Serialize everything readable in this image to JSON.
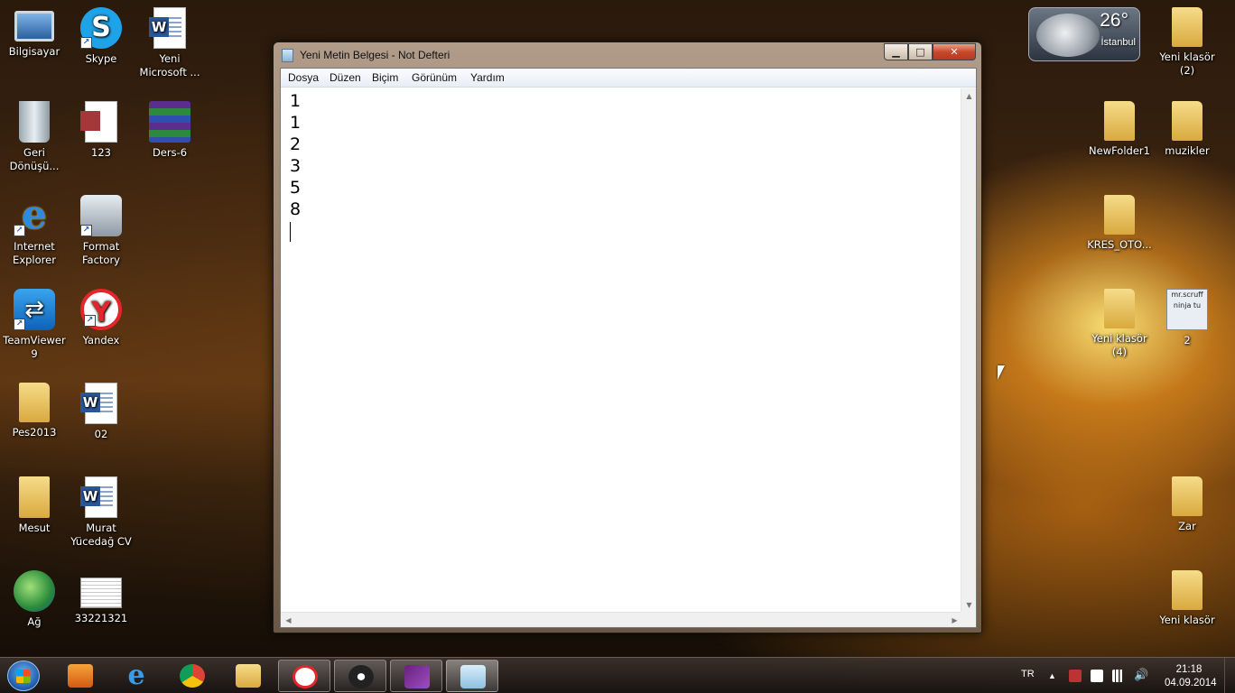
{
  "desktop": {
    "icons_left": [
      {
        "label": "Bilgisayar"
      },
      {
        "label": "Skype"
      },
      {
        "label": "Yeni Microsoft ..."
      },
      {
        "label": "Geri Dönüşü..."
      },
      {
        "label": "123"
      },
      {
        "label": "Ders-6"
      },
      {
        "label": "Internet Explorer"
      },
      {
        "label": "Format Factory"
      },
      {
        "label": "TeamViewer 9"
      },
      {
        "label": "Yandex"
      },
      {
        "label": "Pes2013"
      },
      {
        "label": "02"
      },
      {
        "label": "Mesut"
      },
      {
        "label": "Murat Yücedağ CV"
      },
      {
        "label": "Ağ"
      },
      {
        "label": "33221321"
      }
    ],
    "icons_right": [
      {
        "label": "Yeni klasör (2)"
      },
      {
        "label": "NewFolder1"
      },
      {
        "label": "muzikler"
      },
      {
        "label": "KRES_OTO..."
      },
      {
        "label": "Yeni klasör (4)"
      },
      {
        "label": "2"
      },
      {
        "label": "Zar"
      },
      {
        "label": "Yeni klasör"
      }
    ],
    "mrscruff_text": "mr.scruff ninja tu"
  },
  "weather": {
    "temperature": "26°",
    "city": "İstanbul"
  },
  "notepad": {
    "title": "Yeni Metin Belgesi - Not Defteri",
    "menu": [
      "Dosya",
      "Düzen",
      "Biçim",
      "Görünüm",
      "Yardım"
    ],
    "lines": [
      "1",
      "1",
      "2",
      "3",
      "5",
      "8"
    ]
  },
  "taskbar": {
    "language": "TR",
    "time": "21:18",
    "date": "04.09.2014"
  },
  "colors": {
    "window_close": "#c74a2e",
    "taskbar": "#2a221e"
  }
}
